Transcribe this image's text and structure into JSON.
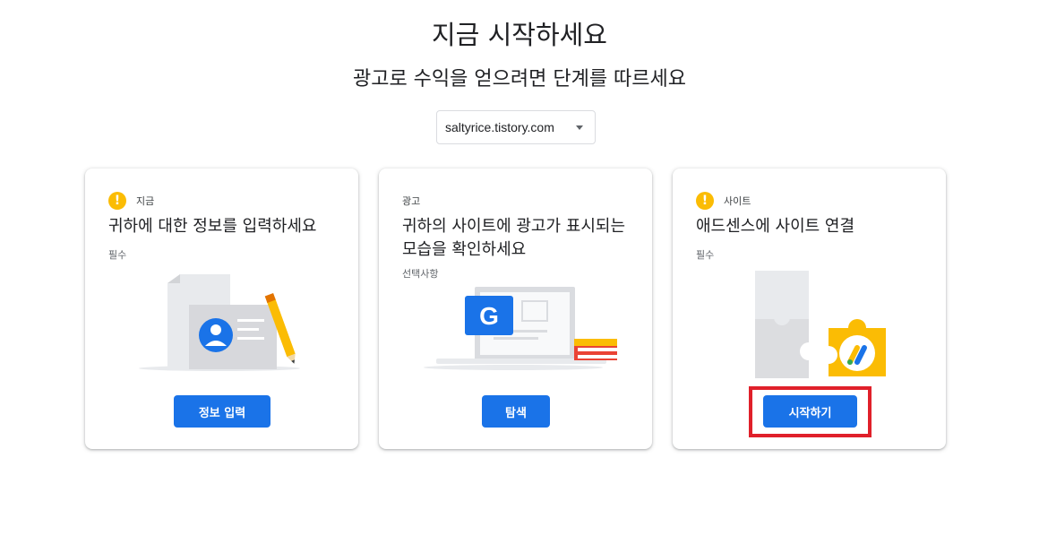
{
  "header": {
    "title": "지금 시작하세요",
    "subtitle": "광고로 수익을 얻으려면 단계를 따르세요"
  },
  "site_select": {
    "value": "saltyrice.tistory.com"
  },
  "cards": [
    {
      "eyebrow": "지금",
      "title": "귀하에 대한 정보를 입력하세요",
      "note": "필수",
      "button": "정보 입력",
      "warning": "!"
    },
    {
      "eyebrow": "광고",
      "title": "귀하의 사이트에 광고가 표시되는 모습을 확인하세요",
      "note": "선택사항",
      "button": "탐색",
      "logo_letter": "G"
    },
    {
      "eyebrow": "사이트",
      "title": "애드센스에 사이트 연결",
      "note": "필수",
      "button": "시작하기",
      "warning": "!"
    }
  ],
  "colors": {
    "primary": "#1a73e8",
    "warning": "#fbbc04",
    "highlight": "#e0202a"
  }
}
